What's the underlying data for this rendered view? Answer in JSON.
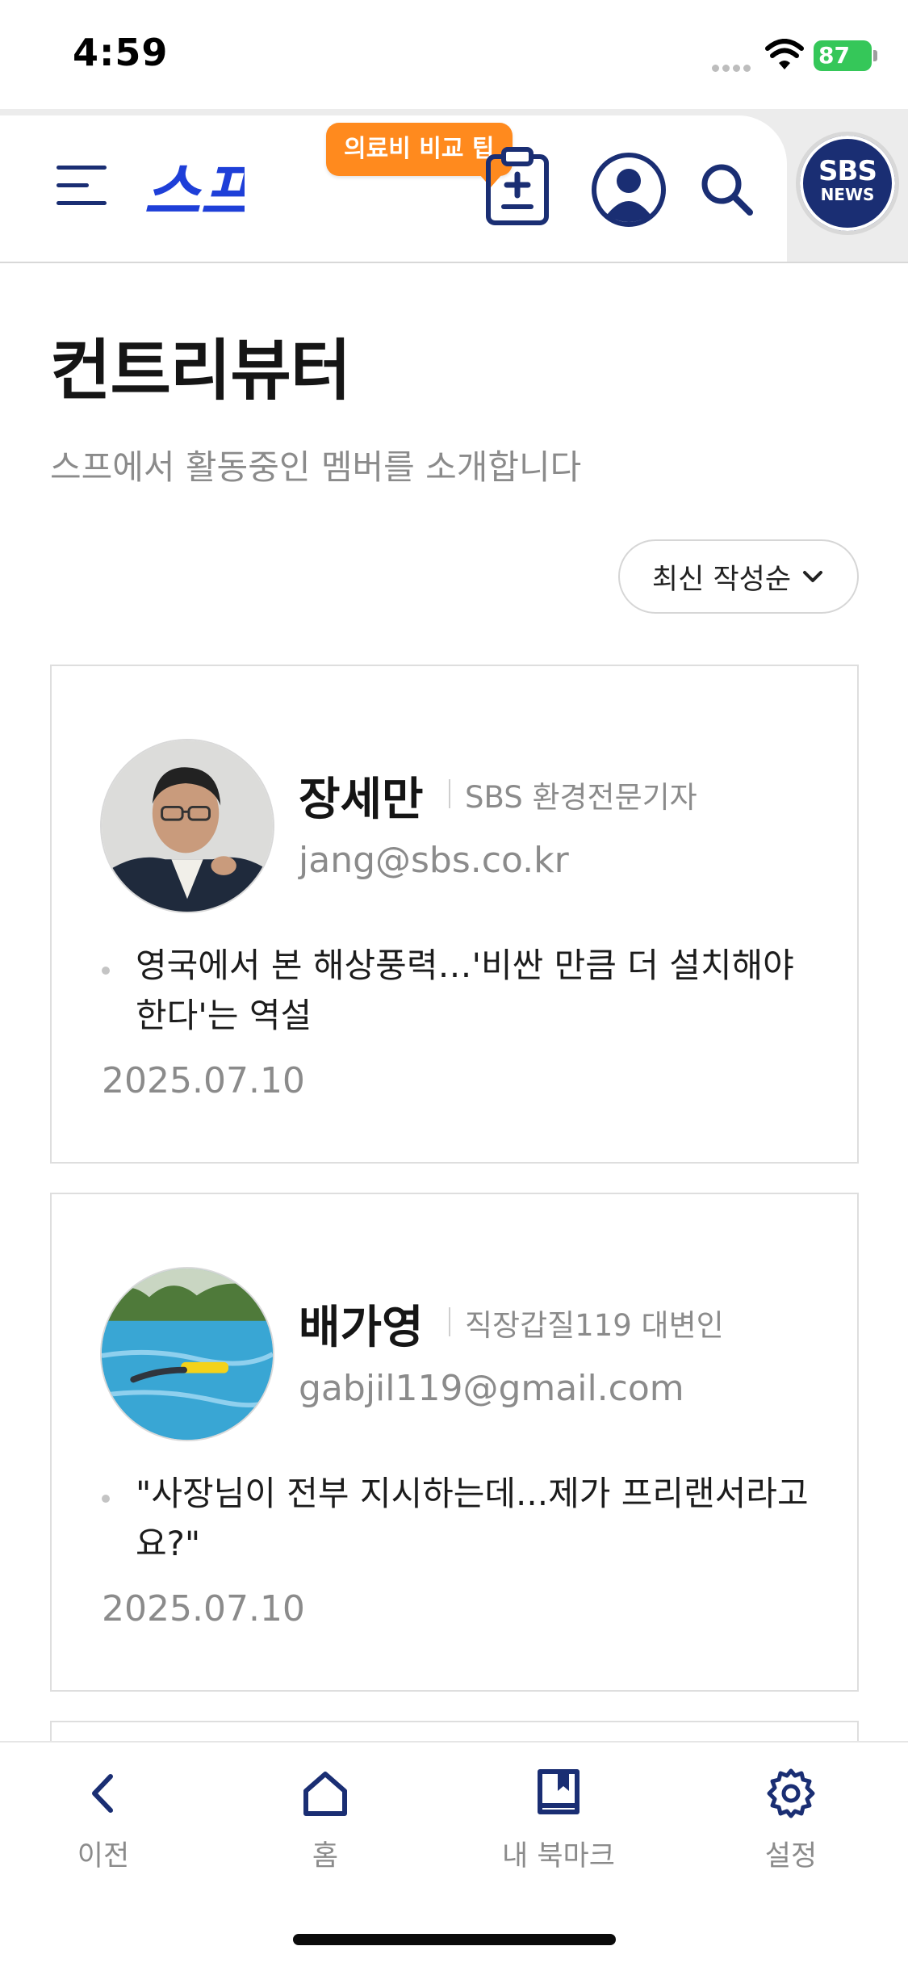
{
  "status_bar": {
    "time": "4:59",
    "battery": "87"
  },
  "header": {
    "logo_text": "스프",
    "tip_badge": "의료비 비교 팁",
    "sbs_badge_top": "SBS",
    "sbs_badge_bottom": "NEWS",
    "icons": [
      "menu-icon",
      "clipboard-plus-icon",
      "profile-icon",
      "search-icon"
    ]
  },
  "page": {
    "title": "컨트리뷰터",
    "subtitle": "스프에서 활동중인 멤버를 소개합니다",
    "sort_label": "최신 작성순"
  },
  "contributors": [
    {
      "name": "장세만",
      "role": "SBS 환경전문기자",
      "email": "jang@sbs.co.kr",
      "article_title": "영국에서 본 해상풍력…'비싼 만큼 더 설치해야 한다'는 역설",
      "date": "2025.07.10"
    },
    {
      "name": "배가영",
      "role": "직장갑질119 대변인",
      "email": "gabjil119@gmail.com",
      "article_title": "\"사장님이 전부 지시하는데...제가 프리랜서라고요?\"",
      "date": "2025.07.10"
    }
  ],
  "bottom_nav": [
    {
      "label": "이전",
      "icon": "chevron-left-icon"
    },
    {
      "label": "홈",
      "icon": "home-icon"
    },
    {
      "label": "내 북마크",
      "icon": "bookmark-icon"
    },
    {
      "label": "설정",
      "icon": "gear-icon"
    }
  ],
  "colors": {
    "brand_navy": "#1a2e73",
    "logo_blue": "#1e3fd8",
    "tip_orange": "#ff8a1e",
    "battery_green": "#35c759"
  }
}
